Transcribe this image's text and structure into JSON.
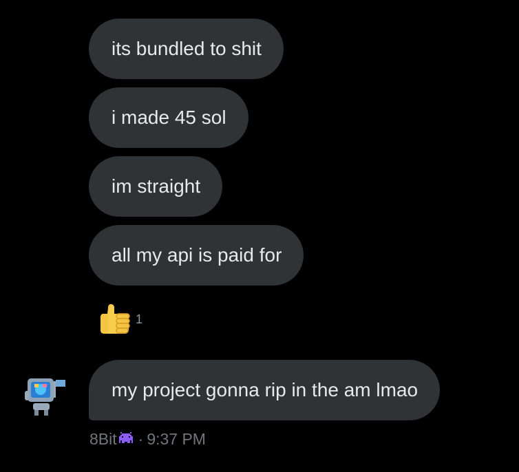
{
  "messages": [
    {
      "text": "its bundled to shit"
    },
    {
      "text": "i made 45 sol"
    },
    {
      "text": "im straight"
    },
    {
      "text": "all my api is paid for"
    },
    {
      "text": "my project gonna rip in the am lmao"
    }
  ],
  "reaction": {
    "emoji": "thumbs-up-icon",
    "count": "1"
  },
  "sender": {
    "name": "8Bit",
    "badge_icon": "pixel-invader-icon",
    "avatar_icon": "retro-computer-robot-avatar",
    "separator": "·",
    "time": "9:37 PM"
  },
  "colors": {
    "background": "#000000",
    "bubble": "#2f3336",
    "text": "#e7e9ea",
    "meta": "#71767b",
    "badge": "#8b5cf6"
  }
}
